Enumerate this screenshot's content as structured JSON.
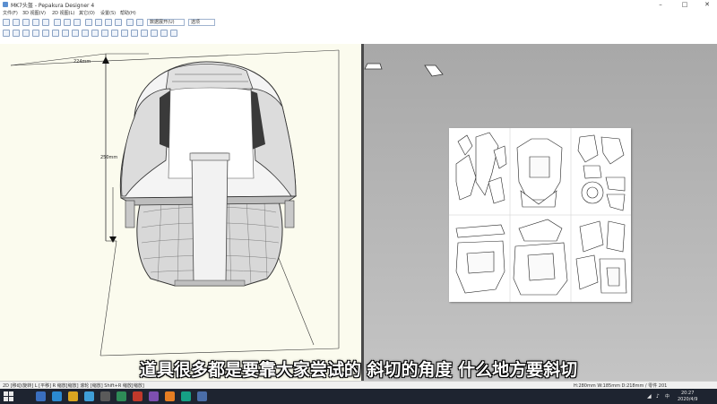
{
  "window": {
    "title": "MK7头盔 - Pepakura Designer 4",
    "minimize": "–",
    "maximize": "□",
    "close": "✕"
  },
  "menu": {
    "items": [
      {
        "label": "文件(F)"
      },
      {
        "label": "3D 视图(V)"
      },
      {
        "label": "2D 视图(L)"
      },
      {
        "label": "其它(O)"
      },
      {
        "label": "设置(S)"
      },
      {
        "label": "帮助(H)"
      }
    ]
  },
  "toolbar": {
    "scale_field": "数据展开(U)",
    "option_field": "选项"
  },
  "view3d": {
    "dim_width": "224mm",
    "dim_height": "250mm"
  },
  "subtitle": "道具很多都是要靠大家尝试的 斜切的角度 什么地方要斜切",
  "statusbar": {
    "left": "2D [移动/旋转] L [平移] R 缩放[缩放] 滚轮 [缩放] Shift+R 缩放[缩放]",
    "right": "H:280mm W:185mm D:218mm / 零件 201"
  },
  "taskbar": {
    "time": "20:27",
    "date": "2020/4/9",
    "ime": "中"
  }
}
